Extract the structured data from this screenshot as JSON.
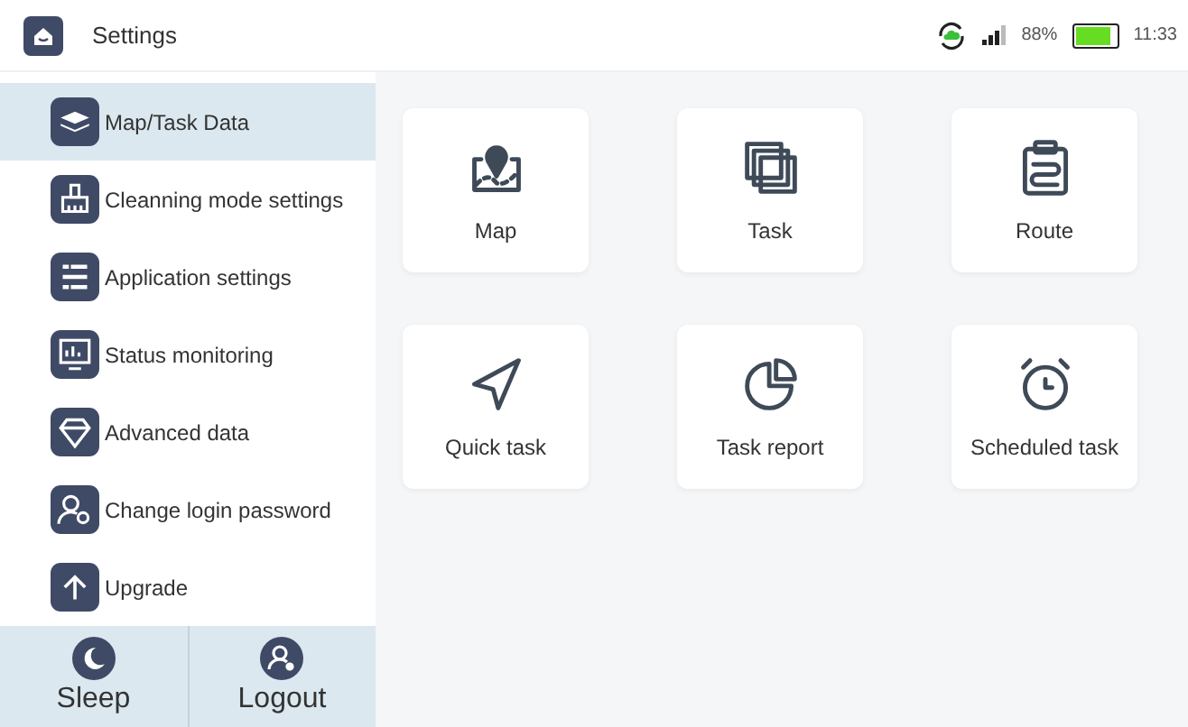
{
  "header": {
    "title": "Settings",
    "battery_text": "88%",
    "battery": {
      "level": 0.88
    },
    "time": "11:33"
  },
  "sidebar": {
    "items": [
      {
        "label": "Map/Task Data",
        "selected": true
      },
      {
        "label": "Cleanning mode settings",
        "selected": false
      },
      {
        "label": "Application settings",
        "selected": false
      },
      {
        "label": "Status monitoring",
        "selected": false
      },
      {
        "label": "Advanced data",
        "selected": false
      },
      {
        "label": "Change login password",
        "selected": false
      },
      {
        "label": "Upgrade",
        "selected": false
      }
    ],
    "bottom_buttons": [
      "Sleep",
      "Logout"
    ]
  },
  "tiles": [
    "Map",
    "Task",
    "Route",
    "Quick task",
    "Task report",
    "Scheduled task"
  ]
}
